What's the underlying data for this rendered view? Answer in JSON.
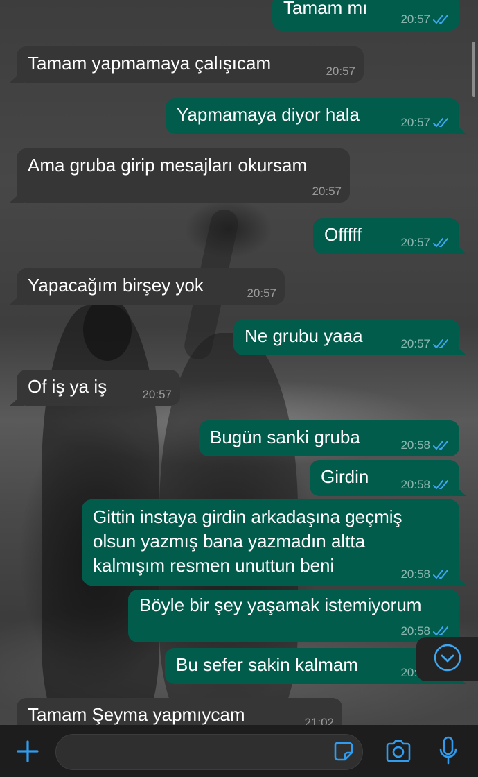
{
  "colors": {
    "outgoing_bubble": "#025c4c",
    "incoming_bubble": "#363636",
    "read_ticks": "#3ea7f2",
    "accent": "#2f9cf0"
  },
  "messages": [
    {
      "direction": "out",
      "text": "Tamam mı",
      "time": "20:57",
      "status": "read"
    },
    {
      "direction": "in",
      "text": "Tamam yapmamaya çalışıcam",
      "time": "20:57"
    },
    {
      "direction": "out",
      "text": "Yapmamaya diyor hala",
      "time": "20:57",
      "status": "read"
    },
    {
      "direction": "in",
      "text": "Ama gruba girip mesajları okursam",
      "time": "20:57"
    },
    {
      "direction": "out",
      "text": "Offfff",
      "time": "20:57",
      "status": "read"
    },
    {
      "direction": "in",
      "text": "Yapacağım birşey yok",
      "time": "20:57"
    },
    {
      "direction": "out",
      "text": "Ne grubu yaaa",
      "time": "20:57",
      "status": "read"
    },
    {
      "direction": "in",
      "text": "Of iş ya iş",
      "time": "20:57"
    },
    {
      "direction": "out",
      "text": "Bugün sanki gruba",
      "time": "20:58",
      "status": "read"
    },
    {
      "direction": "out",
      "text": "Girdin",
      "time": "20:58",
      "status": "read"
    },
    {
      "direction": "out",
      "text": "Gittin instaya girdin arkadaşına geçmiş\nolsun yazmış bana yazmadın altta\nkalmışım resmen unuttun beni",
      "time": "20:58",
      "status": "read"
    },
    {
      "direction": "out",
      "text": "Böyle bir şey yaşamak istemiyorum",
      "time": "20:58",
      "status": "read"
    },
    {
      "direction": "out",
      "text": "Bu sefer sakin kalmam",
      "time": "20:58",
      "status": "read"
    },
    {
      "direction": "in",
      "text": "Tamam Şeyma yapmıycam",
      "time": "21:02"
    }
  ],
  "input_bar": {
    "placeholder": "",
    "icons": [
      "plus-icon",
      "sticker-icon",
      "camera-icon",
      "microphone-icon"
    ]
  },
  "scroll_button_icon": "chevron-down-circle-icon"
}
